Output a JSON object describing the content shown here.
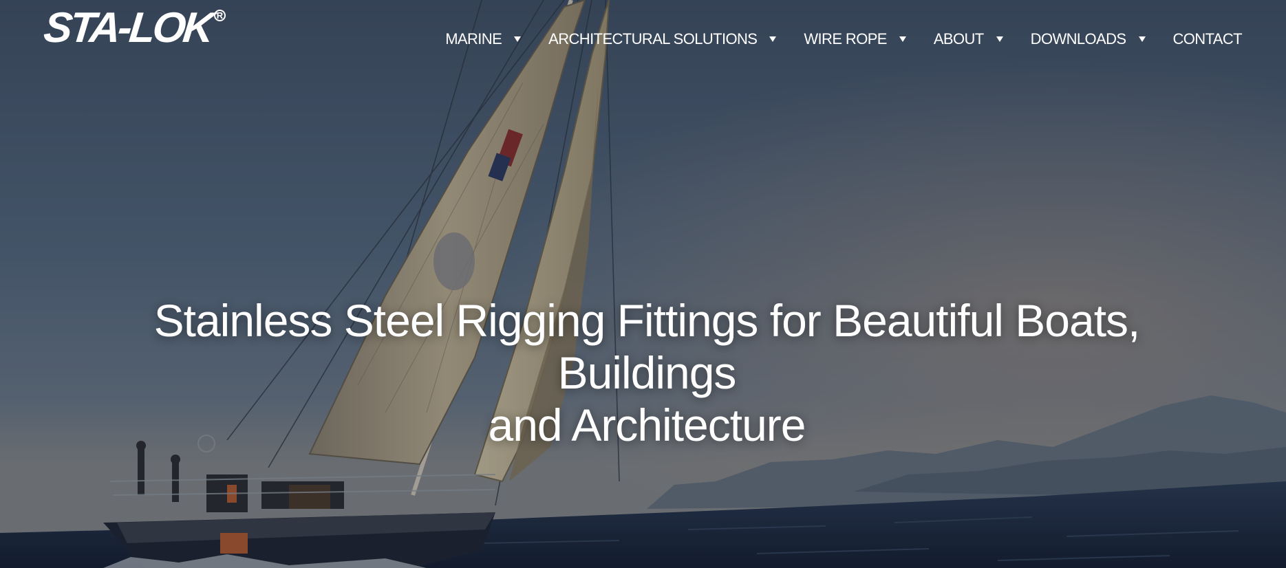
{
  "brand": {
    "logo_text": "STA-LOK",
    "registered_mark": "R"
  },
  "nav": {
    "items": [
      {
        "label": "MARINE",
        "has_dropdown": true
      },
      {
        "label": "ARCHITECTURAL SOLUTIONS",
        "has_dropdown": true
      },
      {
        "label": "WIRE ROPE",
        "has_dropdown": true
      },
      {
        "label": "ABOUT",
        "has_dropdown": true
      },
      {
        "label": "DOWNLOADS",
        "has_dropdown": true
      },
      {
        "label": "CONTACT",
        "has_dropdown": false
      }
    ]
  },
  "hero": {
    "headline_line1": "Stainless Steel Rigging Fittings for Beautiful Boats, Buildings",
    "headline_line2": "and Architecture",
    "image_subject": "sailing-yacht-at-sea"
  },
  "colors": {
    "text": "#ffffff",
    "sky": "#4d5f76",
    "sea": "#1c2a42",
    "sail": "#b7a98a"
  }
}
